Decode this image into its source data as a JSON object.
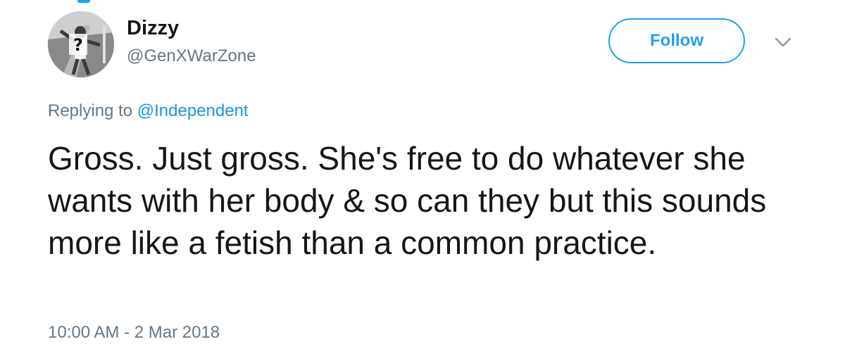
{
  "tweet": {
    "display_name": "Dizzy",
    "handle": "@GenXWarZone",
    "follow_label": "Follow",
    "reply_prefix": "Replying to",
    "reply_mention": "@Independent",
    "text": "Gross. Just gross. She's free to do whatever she wants with her body & so can they but this sounds more like a fetish than a common practice.",
    "timestamp": "10:00 AM - 2 Mar 2018"
  },
  "icons": {
    "avatar": "user-avatar-photo",
    "menu": "chevron-down-icon"
  },
  "colors": {
    "accent": "#1da1f2",
    "mention": "#1b95e0",
    "text_primary": "#14171a",
    "text_secondary": "#657786"
  }
}
